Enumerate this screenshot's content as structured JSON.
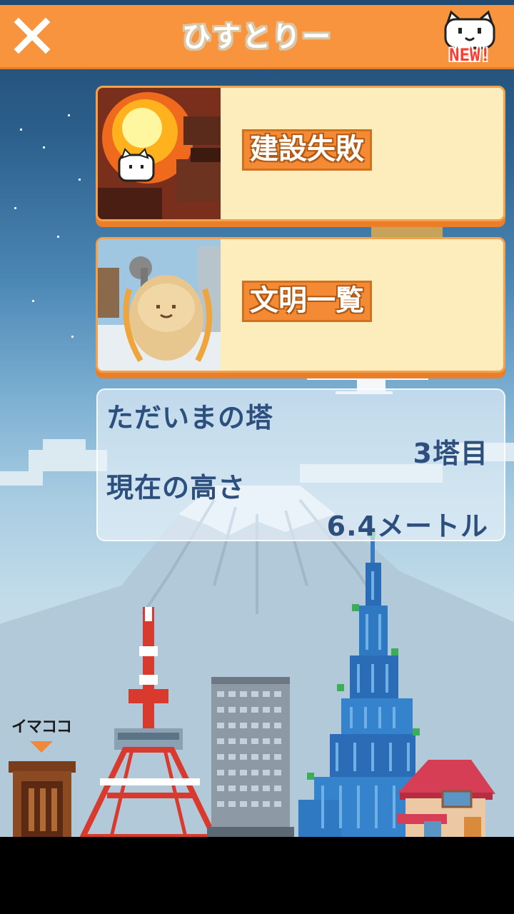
{
  "header": {
    "title": "ひすとりー",
    "close_icon": "close-x-icon",
    "new_icon": "cat-face-icon",
    "new_badge": "NEW!"
  },
  "menu": [
    {
      "label": "建設失敗",
      "thumb": "explosion-cat-thumbnail"
    },
    {
      "label": "文明一覧",
      "thumb": "cat-statue-thumbnail"
    }
  ],
  "info": {
    "current_tower_label": "ただいまの塔",
    "current_tower_value": "3塔目",
    "height_label": "現在の高さ",
    "height_value": "6.4メートル"
  },
  "marker": {
    "label": "イマココ"
  },
  "colors": {
    "header": "#f7943d",
    "card_bg": "#fdecbc",
    "card_label": "#f58a34",
    "info_text": "#2d4f7d"
  }
}
